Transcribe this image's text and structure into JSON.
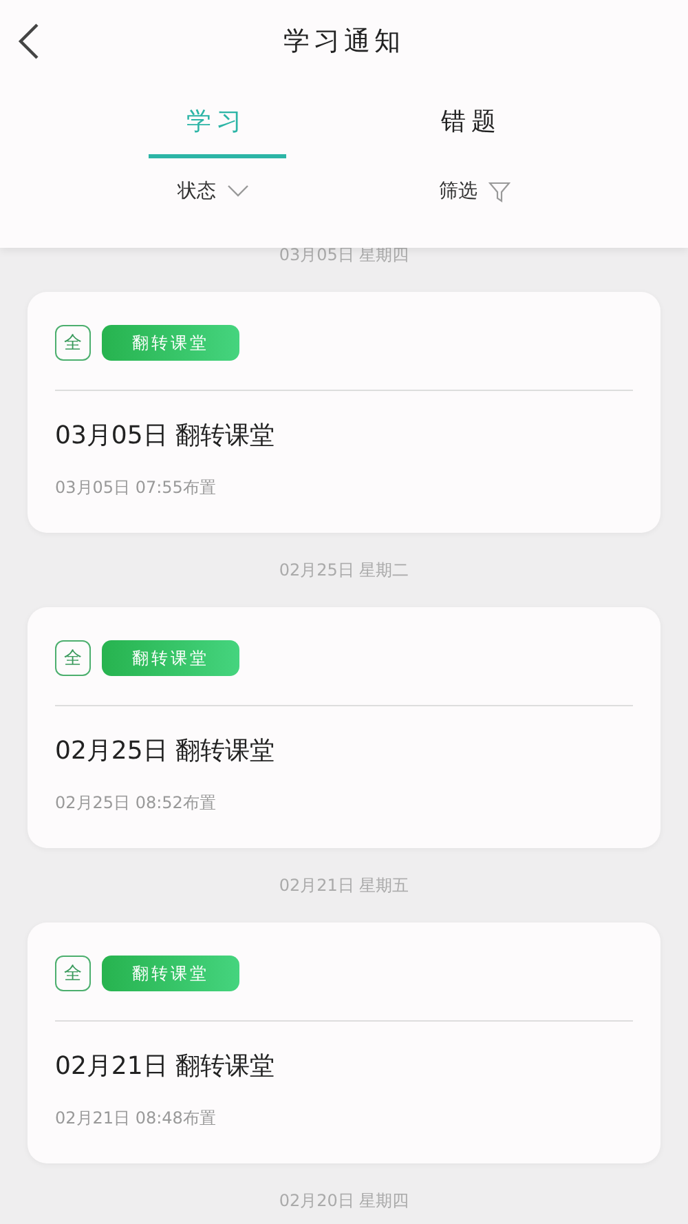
{
  "header": {
    "title": "学习通知"
  },
  "tabs": [
    {
      "label": "学习",
      "selected": true
    },
    {
      "label": "错题",
      "selected": false
    }
  ],
  "filters": [
    {
      "label": "状态",
      "kind": "dropdown"
    },
    {
      "label": "筛选",
      "kind": "filter"
    }
  ],
  "groups": [
    {
      "date": "03月05日 星期四",
      "card": {
        "badge": "全",
        "tag": "翻转课堂",
        "title": "03月05日 翻转课堂",
        "meta": "03月05日 07:55布置"
      }
    },
    {
      "date": "02月25日 星期二",
      "card": {
        "badge": "全",
        "tag": "翻转课堂",
        "title": "02月25日 翻转课堂",
        "meta": "02月25日 08:52布置"
      }
    },
    {
      "date": "02月21日 星期五",
      "card": {
        "badge": "全",
        "tag": "翻转课堂",
        "title": "02月21日 翻转课堂",
        "meta": "02月21日 08:48布置"
      }
    },
    {
      "date": "02月20日 星期四"
    }
  ]
}
